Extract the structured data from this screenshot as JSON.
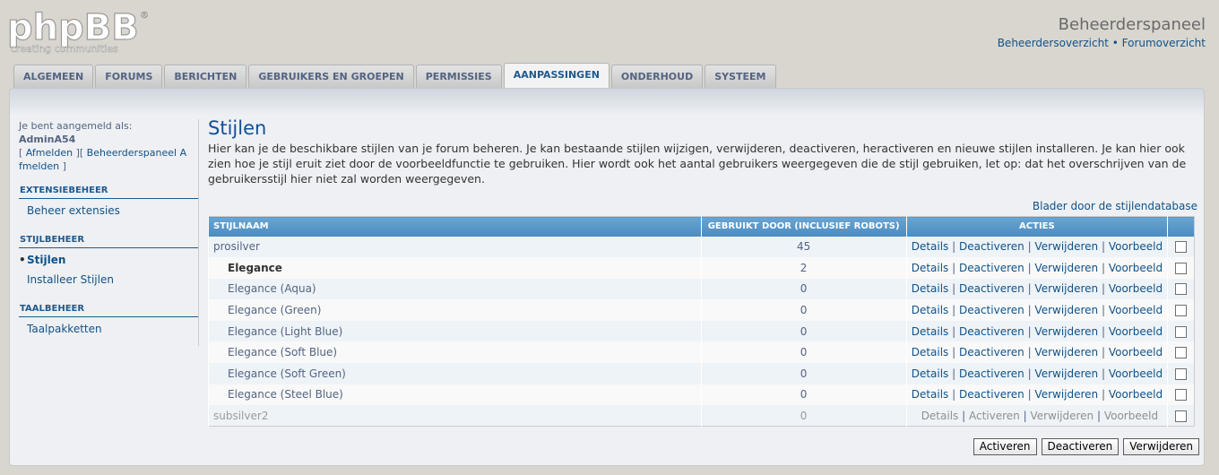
{
  "logo": {
    "text": "phpBB",
    "tagline": "creating communities",
    "reg": "®"
  },
  "header": {
    "title": "Beheerderspaneel",
    "links": [
      "Beheerdersoverzicht",
      "Forumoverzicht"
    ],
    "separator": "•"
  },
  "tabs": [
    {
      "label": "ALGEMEEN",
      "active": false
    },
    {
      "label": "FORUMS",
      "active": false
    },
    {
      "label": "BERICHTEN",
      "active": false
    },
    {
      "label": "GEBRUIKERS EN GROEPEN",
      "active": false
    },
    {
      "label": "PERMISSIES",
      "active": false
    },
    {
      "label": "AANPASSINGEN",
      "active": true
    },
    {
      "label": "ONDERHOUD",
      "active": false
    },
    {
      "label": "SYSTEEM",
      "active": false
    }
  ],
  "sidebar": {
    "logged_in_as": "Je bent aangemeld als:",
    "username": "AdminA54",
    "logout": "Afmelden",
    "admin_logout": "Beheerderspaneel A fmelden",
    "sections": [
      {
        "heading": "EXTENSIEBEHEER",
        "items": [
          {
            "label": "Beheer extensies",
            "active": false
          }
        ]
      },
      {
        "heading": "STIJLBEHEER",
        "items": [
          {
            "label": "Stijlen",
            "active": true
          },
          {
            "label": "Installeer Stijlen",
            "active": false
          }
        ]
      },
      {
        "heading": "TAALBEHEER",
        "items": [
          {
            "label": "Taalpakketten",
            "active": false
          }
        ]
      }
    ]
  },
  "main": {
    "title": "Stijlen",
    "description": "Hier kan je de beschikbare stijlen van je forum beheren. Je kan bestaande stijlen wijzigen, verwijderen, deactiveren, heractiveren en nieuwe stijlen installeren. Je kan hier ook zien hoe je stijl eruit ziet door de voorbeeldfunctie te gebruiken. Hier wordt ook het aantal gebruikers weergegeven die de stijl gebruiken, let op: dat het overschrijven van de gebruikersstijl hier niet zal worden weergegeven.",
    "browse_link": "Blader door de stijlendatabase"
  },
  "table": {
    "headers": [
      "STIJLNAAM",
      "GEBRUIKT DOOR (INCLUSIEF ROBOTS)",
      "ACTIES",
      ""
    ],
    "rows": [
      {
        "name": "prosilver",
        "count": "45",
        "actions": [
          "Details",
          "Deactiveren",
          "Verwijderen",
          "Voorbeeld"
        ],
        "child": false,
        "bold": false,
        "inactive": false
      },
      {
        "name": "Elegance",
        "count": "2",
        "actions": [
          "Details",
          "Deactiveren",
          "Verwijderen",
          "Voorbeeld"
        ],
        "child": true,
        "bold": true,
        "inactive": false
      },
      {
        "name": "Elegance (Aqua)",
        "count": "0",
        "actions": [
          "Details",
          "Deactiveren",
          "Verwijderen",
          "Voorbeeld"
        ],
        "child": true,
        "bold": false,
        "inactive": false
      },
      {
        "name": "Elegance (Green)",
        "count": "0",
        "actions": [
          "Details",
          "Deactiveren",
          "Verwijderen",
          "Voorbeeld"
        ],
        "child": true,
        "bold": false,
        "inactive": false
      },
      {
        "name": "Elegance (Light Blue)",
        "count": "0",
        "actions": [
          "Details",
          "Deactiveren",
          "Verwijderen",
          "Voorbeeld"
        ],
        "child": true,
        "bold": false,
        "inactive": false
      },
      {
        "name": "Elegance (Soft Blue)",
        "count": "0",
        "actions": [
          "Details",
          "Deactiveren",
          "Verwijderen",
          "Voorbeeld"
        ],
        "child": true,
        "bold": false,
        "inactive": false
      },
      {
        "name": "Elegance (Soft Green)",
        "count": "0",
        "actions": [
          "Details",
          "Deactiveren",
          "Verwijderen",
          "Voorbeeld"
        ],
        "child": true,
        "bold": false,
        "inactive": false
      },
      {
        "name": "Elegance (Steel Blue)",
        "count": "0",
        "actions": [
          "Details",
          "Deactiveren",
          "Verwijderen",
          "Voorbeeld"
        ],
        "child": true,
        "bold": false,
        "inactive": false
      },
      {
        "name": "subsilver2",
        "count": "0",
        "actions": [
          "Details",
          "Activeren",
          "Verwijderen",
          "Voorbeeld"
        ],
        "child": false,
        "bold": false,
        "inactive": true
      }
    ]
  },
  "buttons": {
    "activate": "Activeren",
    "deactivate": "Deactiveren",
    "delete": "Verwijderen"
  }
}
